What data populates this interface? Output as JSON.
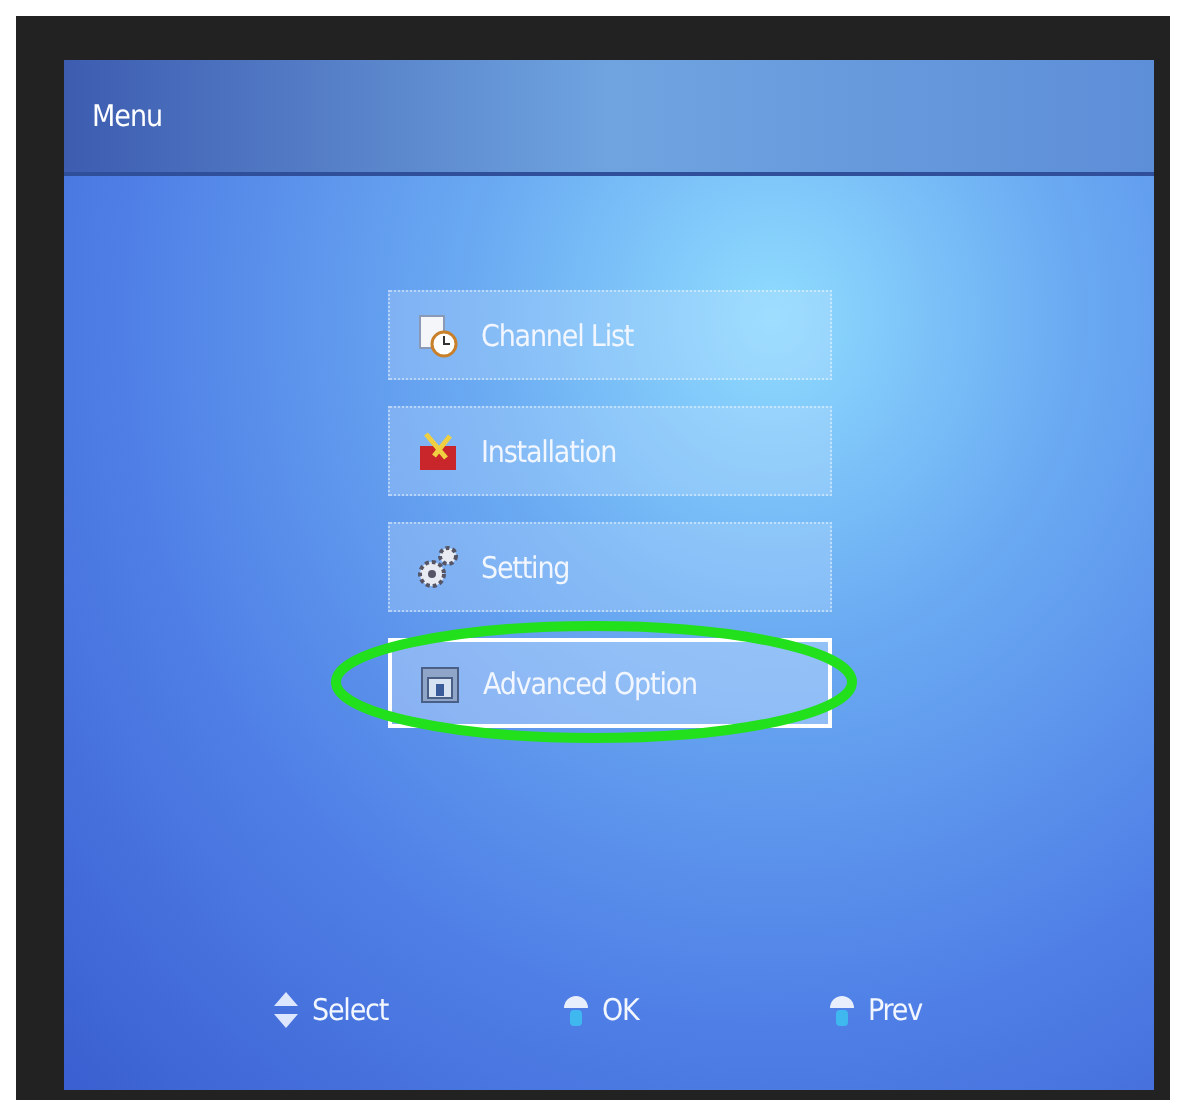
{
  "header": {
    "title": "Menu"
  },
  "menu_items": [
    {
      "label": "Channel List",
      "selected": false
    },
    {
      "label": "Installation",
      "selected": false
    },
    {
      "label": "Setting",
      "selected": false
    },
    {
      "label": "Advanced Option",
      "selected": true
    }
  ],
  "key_hints": [
    {
      "label": "Select"
    },
    {
      "label": "OK"
    },
    {
      "label": "Prev"
    }
  ]
}
